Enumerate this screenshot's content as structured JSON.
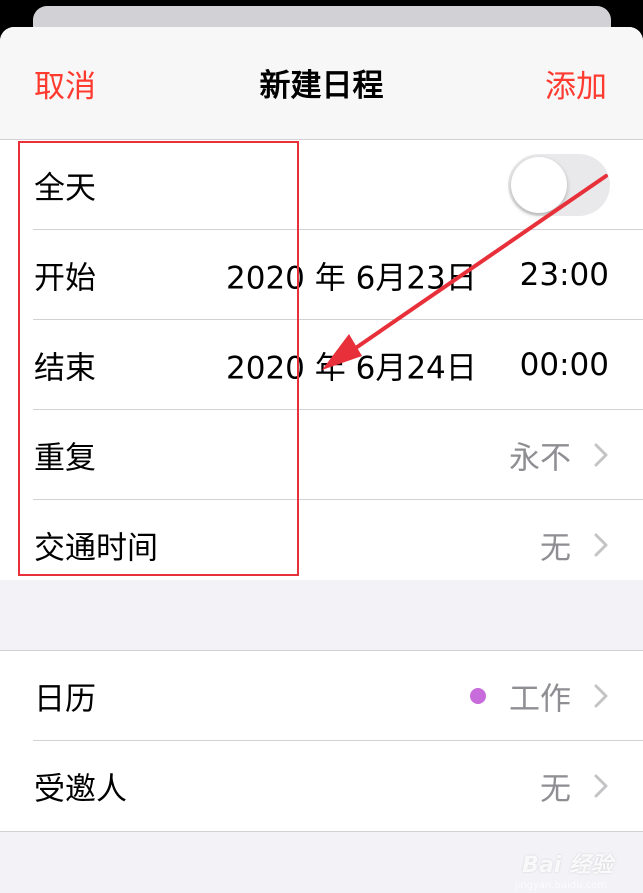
{
  "nav": {
    "cancel_label": "取消",
    "title": "新建日程",
    "add_label": "添加"
  },
  "event": {
    "all_day": {
      "label": "全天",
      "on": false
    },
    "start": {
      "label": "开始",
      "date": "2020 年 6月23日",
      "time": "23:00"
    },
    "end": {
      "label": "结束",
      "date": "2020 年 6月24日",
      "time": "00:00"
    },
    "repeat": {
      "label": "重复",
      "value": "永不"
    },
    "travel_time": {
      "label": "交通时间",
      "value": "无"
    }
  },
  "calendar_section": {
    "calendar": {
      "label": "日历",
      "value": "工作",
      "dot_color": "#c86bdb"
    },
    "invitees": {
      "label": "受邀人",
      "value": "无"
    }
  },
  "colors": {
    "accent": "#ff3b30",
    "secondary_text": "#8e8e93",
    "annotation": "#e8303a"
  },
  "watermark": {
    "text": "Bai 经验",
    "sub": "jingyan.baidu.com"
  }
}
